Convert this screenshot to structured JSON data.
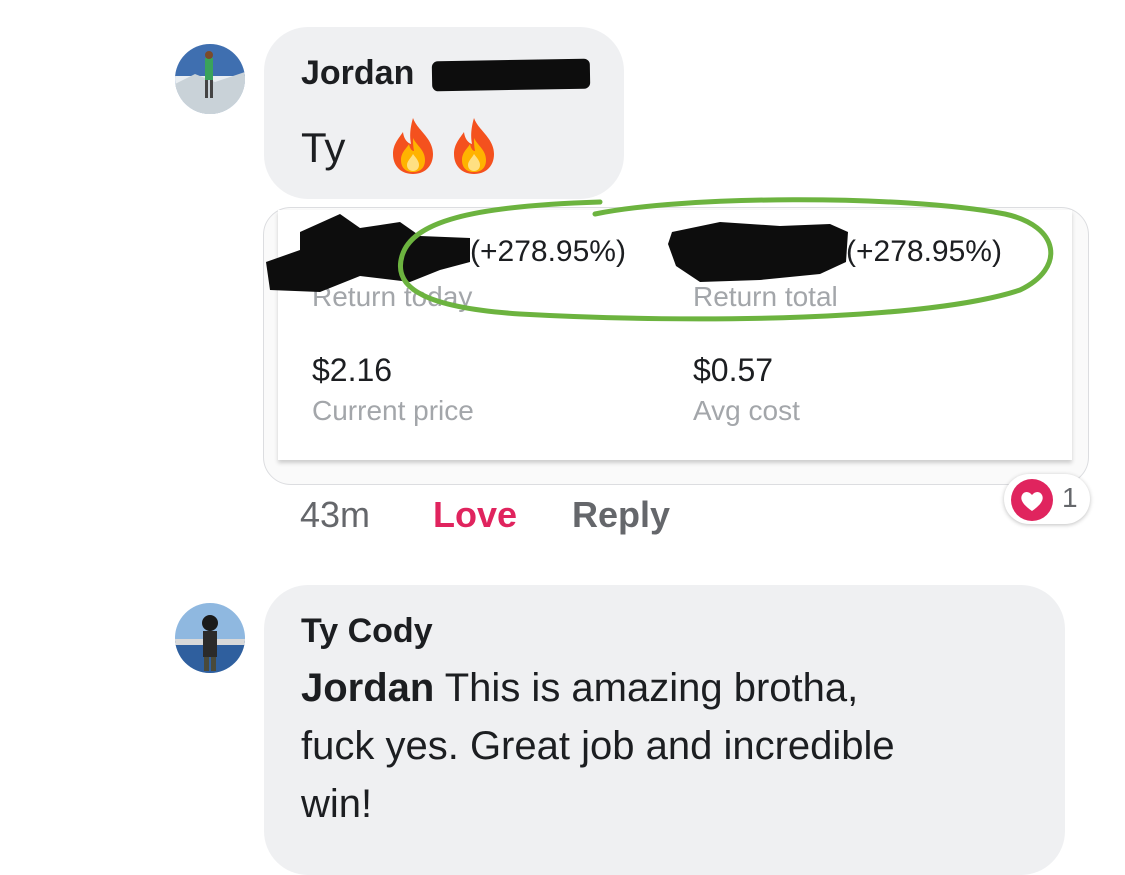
{
  "comments": [
    {
      "author": "Jordan",
      "text": "Ty",
      "emojis": [
        "fire-icon",
        "fire-icon"
      ],
      "time": "43m",
      "actions": {
        "love": "Love",
        "reply": "Reply"
      },
      "reaction": {
        "icon": "heart-icon",
        "count": "1"
      },
      "attachment": {
        "return_today_pct": "(+278.95%)",
        "return_today_label": "Return today",
        "return_total_pct": "(+278.95%)",
        "return_total_label": "Return total",
        "current_price": "$2.16",
        "current_price_label": "Current price",
        "avg_cost": "$0.57",
        "avg_cost_label": "Avg cost"
      }
    },
    {
      "author": "Ty Cody",
      "mention": "Jordan",
      "text_line1": " This is amazing brotha,",
      "text_line2": "fuck yes. Great job and incredible",
      "text_line3": "win!"
    }
  ],
  "colors": {
    "bubble": "#eff0f2",
    "love": "#e0245e",
    "muted": "#65676b",
    "annotation": "#6cb33f"
  }
}
